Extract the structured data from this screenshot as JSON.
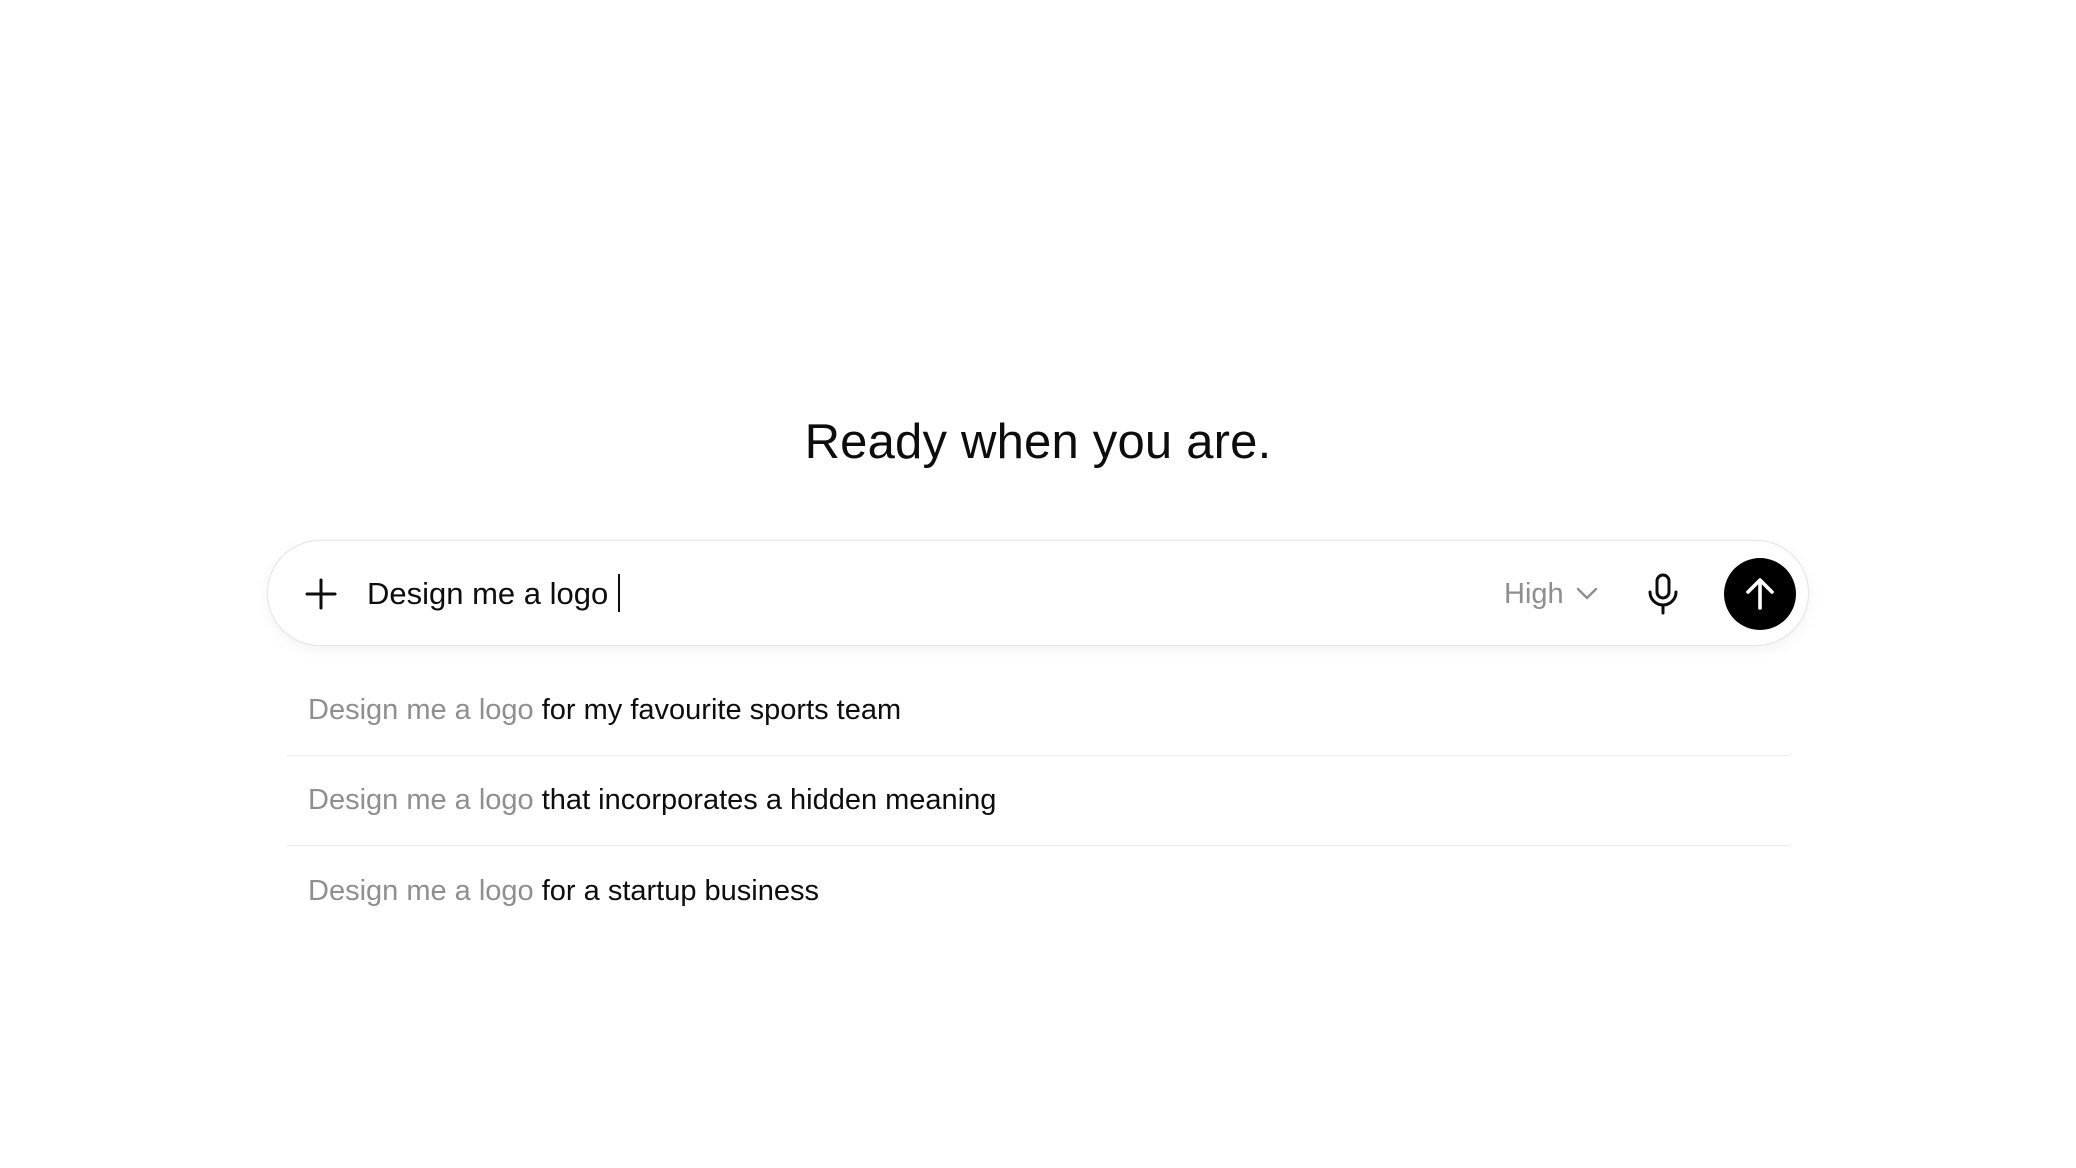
{
  "headline": "Ready when you are.",
  "composer": {
    "input_value": "Design me a logo",
    "mode_label": "High",
    "icons": {
      "add": "plus-icon",
      "mode_dropdown": "chevron-down-icon",
      "voice": "microphone-icon",
      "send": "arrow-up-icon"
    }
  },
  "suggestions": [
    {
      "prefix": "Design me a logo",
      "rest": "for my favourite sports team"
    },
    {
      "prefix": "Design me a logo",
      "rest": "that incorporates a hidden meaning"
    },
    {
      "prefix": "Design me a logo",
      "rest": "for a startup business"
    }
  ],
  "colors": {
    "background": "#ffffff",
    "text_primary": "#0d0d0d",
    "text_muted": "#8f8f8f",
    "send_button": "#000000",
    "divider": "#ececec"
  }
}
